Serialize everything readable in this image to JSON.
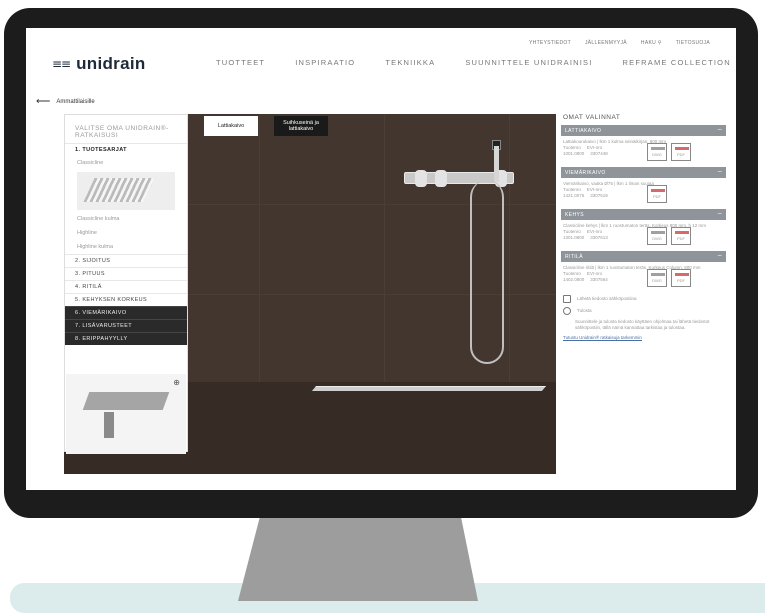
{
  "header": {
    "logo_mark": "≡≡",
    "logo_text": "unidrain",
    "utility": [
      "YHTEYSTIEDOT",
      "JÄLLEENMYYJÄ",
      "HAKU",
      "TIETOSUOJA"
    ],
    "search_icon": "search-icon",
    "nav": [
      "TUOTTEET",
      "INSPIRAATIO",
      "TEKNIIKKA",
      "SUUNNITTELE UNIDRAINISI",
      "REFRAME COLLECTION"
    ]
  },
  "back_link": "Ammattilaisille",
  "room_tabs": [
    "Lattiakaivo",
    "Suihkuseinä ja lattiakaivo"
  ],
  "configurator": {
    "title": "VALITSE OMA UNIDRAIN®-RATKAISUSI",
    "first_step": "1. TUOTESARJAT",
    "options": [
      "Classicline",
      "Classicline kulma",
      "Highline",
      "Highline kulma"
    ],
    "steps": [
      "2. SIJOITUS",
      "3. PITUUS",
      "4. RITILÄ",
      "5. KEHYKSEN KORKEUS",
      "6. VIEMÄRIKAIVO",
      "7. LISÄVARUSTEET",
      "8. ERIPPAHYYLLY"
    ],
    "zoom_icon": "zoom-icon"
  },
  "selections": {
    "title": "OMAT VALINNAT",
    "sections": [
      {
        "head": "LATTIAKAIVO",
        "body": "Lattiakourukaivo | lkm 1 kulma seinäikirjan, 800 mm",
        "code_label": "Tuotenro",
        "code": "1001.0800",
        "num_label": "EVI-nro",
        "num": "3307448",
        "files": [
          "DWG",
          "PDF"
        ]
      },
      {
        "head": "VIEMÄRIKAIVO",
        "body": "Viemärikaivo, vaaka Ø75 | lkm 1 ilman suojaa",
        "code_label": "Tuotenro",
        "code": "1421.0075",
        "num_label": "EVI-nro",
        "num": "3307519",
        "files": [
          "PDF"
        ]
      },
      {
        "head": "KEHYS",
        "body": "Classicline kehys | lkm 1 ruostumaton teräs, Korkeus 800 mm, h 12 mm",
        "code_label": "Tuotenro",
        "code": "1301.0800",
        "num_label": "EVI-nro",
        "num": "3307613",
        "files": [
          "DWG",
          "PDF"
        ]
      },
      {
        "head": "RITILÄ",
        "body": "Classicline ritilä | lkm 1 ruostumaton teräs, Korkeus Column, 800 mm",
        "code_label": "Tuotenro",
        "code": "1402.0800",
        "num_label": "EVI-nro",
        "num": "3307564",
        "files": [
          "DWG",
          "PDF"
        ]
      }
    ],
    "send_label": "Lähetä tiedosto sähköpostiina",
    "print_label": "Tulosta",
    "info_text": "Suunnittele ja tulosta tiedosto käyttäen ohjelmaa tai lähetä tiedostot sähköpostiin, tällä nämä kannattaa tarkistaa ja tulostaa.",
    "link_text": "Tutustu Unidrain® ratkaisuja tarkemmin"
  }
}
